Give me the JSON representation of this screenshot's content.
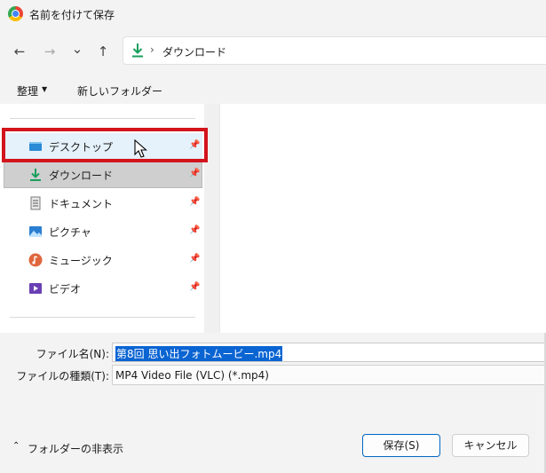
{
  "window": {
    "title": "名前を付けて保存"
  },
  "nav": {
    "back_icon": "←",
    "forward_icon": "→",
    "recent_icon": "⌄",
    "up_icon": "↑",
    "address_chevron": "›",
    "address": "ダウンロード"
  },
  "toolbar": {
    "organize": "整理",
    "organize_caret": "▼",
    "new_folder": "新しいフォルダー"
  },
  "sidebar": {
    "items": [
      {
        "label": "デスクトップ",
        "icon": "desktop-icon"
      },
      {
        "label": "ダウンロード",
        "icon": "download-icon"
      },
      {
        "label": "ドキュメント",
        "icon": "document-icon"
      },
      {
        "label": "ピクチャ",
        "icon": "pictures-icon"
      },
      {
        "label": "ミュージック",
        "icon": "music-icon"
      },
      {
        "label": "ビデオ",
        "icon": "videos-icon"
      }
    ],
    "pin_glyph": "📌"
  },
  "form": {
    "filename_label": "ファイル名(N):",
    "filename_value": "第8回 思い出フォトムービー.mp4",
    "filetype_label": "ファイルの種類(T):",
    "filetype_value": "MP4 Video File (VLC) (*.mp4)"
  },
  "footer": {
    "hide_folders_caret": "⌃",
    "hide_folders": "フォルダーの非表示",
    "save": "保存(S)",
    "cancel": "キャンセル"
  },
  "colors": {
    "accent": "#0067c0",
    "highlight": "#d2141c",
    "selection": "#0a64d2",
    "download_green": "#1a9e5c"
  }
}
